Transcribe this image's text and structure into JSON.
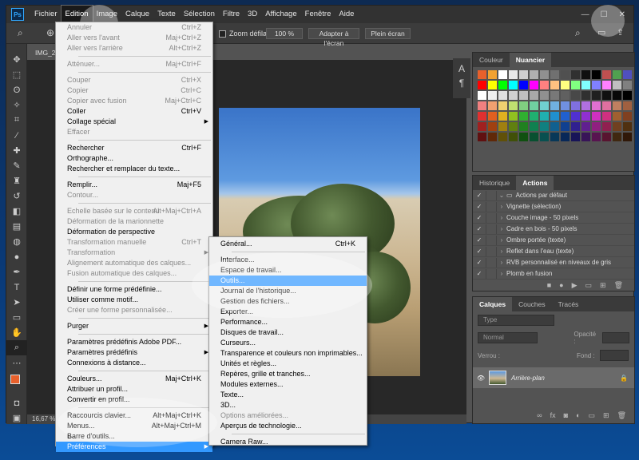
{
  "menubar": {
    "logo": "Ps",
    "items": [
      "Fichier",
      "Edition",
      "Image",
      "Calque",
      "Texte",
      "Sélection",
      "Filtre",
      "3D",
      "Affichage",
      "Fenêtre",
      "Aide"
    ],
    "active": "Edition",
    "window_controls": [
      "—",
      "☐",
      "✕"
    ]
  },
  "options": {
    "zoom_scroll_label": "Zoom défilant",
    "zoom_value": "100 %",
    "fit_screen": "Adapter à l'écran",
    "full_screen": "Plein écran"
  },
  "document": {
    "tab_label": "IMG_20",
    "status_zoom": "16,67 %"
  },
  "edit_menu": [
    {
      "label": "Annuler",
      "shortcut": "Ctrl+Z",
      "disabled": true
    },
    {
      "label": "Aller vers l'avant",
      "shortcut": "Maj+Ctrl+Z",
      "disabled": true
    },
    {
      "label": "Aller vers l'arrière",
      "shortcut": "Alt+Ctrl+Z",
      "disabled": true
    },
    {
      "sep": true
    },
    {
      "label": "Atténuer...",
      "shortcut": "Maj+Ctrl+F",
      "disabled": true
    },
    {
      "sep": true
    },
    {
      "label": "Couper",
      "shortcut": "Ctrl+X",
      "disabled": true
    },
    {
      "label": "Copier",
      "shortcut": "Ctrl+C",
      "disabled": true
    },
    {
      "label": "Copier avec fusion",
      "shortcut": "Maj+Ctrl+C",
      "disabled": true
    },
    {
      "label": "Coller",
      "shortcut": "Ctrl+V",
      "disabled": false
    },
    {
      "label": "Collage spécial",
      "shortcut": "",
      "disabled": false,
      "submenu": true
    },
    {
      "label": "Effacer",
      "shortcut": "",
      "disabled": true
    },
    {
      "sep": true
    },
    {
      "label": "Rechercher",
      "shortcut": "Ctrl+F",
      "disabled": false
    },
    {
      "label": "Orthographe...",
      "shortcut": "",
      "disabled": false
    },
    {
      "label": "Rechercher et remplacer du texte...",
      "shortcut": "",
      "disabled": false
    },
    {
      "sep": true
    },
    {
      "label": "Remplir...",
      "shortcut": "Maj+F5",
      "disabled": false
    },
    {
      "label": "Contour...",
      "shortcut": "",
      "disabled": true
    },
    {
      "sep": true
    },
    {
      "label": "Echelle basée sur le contenu",
      "shortcut": "Alt+Maj+Ctrl+A",
      "disabled": true
    },
    {
      "label": "Déformation de la marionnette",
      "shortcut": "",
      "disabled": true
    },
    {
      "label": "Déformation de perspective",
      "shortcut": "",
      "disabled": false
    },
    {
      "label": "Transformation manuelle",
      "shortcut": "Ctrl+T",
      "disabled": true
    },
    {
      "label": "Transformation",
      "shortcut": "",
      "disabled": true,
      "submenu": true
    },
    {
      "label": "Alignement automatique des calques...",
      "shortcut": "",
      "disabled": true
    },
    {
      "label": "Fusion automatique des calques...",
      "shortcut": "",
      "disabled": true
    },
    {
      "sep": true
    },
    {
      "label": "Définir une forme prédéfinie...",
      "shortcut": "",
      "disabled": false
    },
    {
      "label": "Utiliser comme motif...",
      "shortcut": "",
      "disabled": false
    },
    {
      "label": "Créer une forme personnalisée...",
      "shortcut": "",
      "disabled": true
    },
    {
      "sep": true
    },
    {
      "label": "Purger",
      "shortcut": "",
      "disabled": false,
      "submenu": true
    },
    {
      "sep": true
    },
    {
      "label": "Paramètres prédéfinis Adobe PDF...",
      "shortcut": "",
      "disabled": false
    },
    {
      "label": "Paramètres prédéfinis",
      "shortcut": "",
      "disabled": false,
      "submenu": true
    },
    {
      "label": "Connexions à distance...",
      "shortcut": "",
      "disabled": false
    },
    {
      "sep": true
    },
    {
      "label": "Couleurs...",
      "shortcut": "Maj+Ctrl+K",
      "disabled": false
    },
    {
      "label": "Attribuer un profil...",
      "shortcut": "",
      "disabled": false
    },
    {
      "label": "Convertir en profil...",
      "shortcut": "",
      "disabled": false
    },
    {
      "sep": true
    },
    {
      "label": "Raccourcis clavier...",
      "shortcut": "Alt+Maj+Ctrl+K",
      "disabled": false
    },
    {
      "label": "Menus...",
      "shortcut": "Alt+Maj+Ctrl+M",
      "disabled": false
    },
    {
      "label": "Barre d'outils...",
      "shortcut": "",
      "disabled": false
    },
    {
      "label": "Préférences",
      "shortcut": "",
      "disabled": false,
      "submenu": true,
      "highlighted": true
    }
  ],
  "prefs_menu": [
    {
      "label": "Général...",
      "shortcut": "Ctrl+K",
      "disabled": false
    },
    {
      "sep": true
    },
    {
      "label": "Interface...",
      "shortcut": "",
      "disabled": false
    },
    {
      "label": "Espace de travail...",
      "shortcut": "",
      "disabled": false
    },
    {
      "label": "Outils...",
      "shortcut": "",
      "disabled": false,
      "highlighted": true
    },
    {
      "label": "Journal de l'historique...",
      "shortcut": "",
      "disabled": false
    },
    {
      "label": "Gestion des fichiers...",
      "shortcut": "",
      "disabled": false
    },
    {
      "label": "Exporter...",
      "shortcut": "",
      "disabled": false
    },
    {
      "label": "Performance...",
      "shortcut": "",
      "disabled": false
    },
    {
      "label": "Disques de travail...",
      "shortcut": "",
      "disabled": false
    },
    {
      "label": "Curseurs...",
      "shortcut": "",
      "disabled": false
    },
    {
      "label": "Transparence et couleurs non imprimables...",
      "shortcut": "",
      "disabled": false
    },
    {
      "label": "Unités et règles...",
      "shortcut": "",
      "disabled": false
    },
    {
      "label": "Repères, grille et tranches...",
      "shortcut": "",
      "disabled": false
    },
    {
      "label": "Modules externes...",
      "shortcut": "",
      "disabled": false
    },
    {
      "label": "Texte...",
      "shortcut": "",
      "disabled": false
    },
    {
      "label": "3D...",
      "shortcut": "",
      "disabled": false
    },
    {
      "label": "Options améliorées...",
      "shortcut": "",
      "disabled": true
    },
    {
      "label": "Aperçus de technologie...",
      "shortcut": "",
      "disabled": false
    },
    {
      "sep": true
    },
    {
      "label": "Camera Raw...",
      "shortcut": "",
      "disabled": false
    }
  ],
  "swatches_panel": {
    "tabs": [
      "Couleur",
      "Nuancier"
    ],
    "active": "Nuancier",
    "colors": [
      "#e8602b",
      "#f1a132",
      "#ffffff",
      "#e8e8e8",
      "#d0d0d0",
      "#b0b0b0",
      "#909090",
      "#707070",
      "#505050",
      "#303030",
      "#101010",
      "#000000",
      "#c05050",
      "#50a050",
      "#5050c0",
      "#ff0000",
      "#ffff00",
      "#00ff00",
      "#00ffff",
      "#0000ff",
      "#ff00ff",
      "#ff8080",
      "#ffc080",
      "#ffff80",
      "#80ff80",
      "#80ffff",
      "#8080ff",
      "#ff80ff",
      "#c0c0c0",
      "#808080",
      "#ffffff",
      "#f0f0f0",
      "#e0e0e0",
      "#d0d0d0",
      "#c0c0c0",
      "#a8a8a8",
      "#909090",
      "#787878",
      "#606060",
      "#484848",
      "#303030",
      "#202020",
      "#101010",
      "#080808",
      "#000000",
      "#f08080",
      "#f0a070",
      "#f0d070",
      "#c0e070",
      "#80d080",
      "#70d0a0",
      "#70d0d0",
      "#70b0e0",
      "#7090e0",
      "#8070e0",
      "#b070e0",
      "#e070d0",
      "#e070a0",
      "#c08060",
      "#a06040",
      "#e03030",
      "#e06020",
      "#e0b020",
      "#90c020",
      "#30b030",
      "#20b070",
      "#20b0b0",
      "#2090d0",
      "#2060d0",
      "#5030d0",
      "#9030d0",
      "#d030c0",
      "#d03080",
      "#a06030",
      "#804020",
      "#a02020",
      "#a04010",
      "#a08010",
      "#608010",
      "#208020",
      "#108050",
      "#108080",
      "#106090",
      "#104090",
      "#302090",
      "#602090",
      "#902080",
      "#902050",
      "#704020",
      "#503010",
      "#601010",
      "#602808",
      "#605008",
      "#405008",
      "#105010",
      "#085030",
      "#085050",
      "#083858",
      "#082858",
      "#181458",
      "#381458",
      "#581450",
      "#581430",
      "#402810",
      "#301808"
    ]
  },
  "actions_panel": {
    "tabs": [
      "Historique",
      "Actions"
    ],
    "active": "Actions",
    "items": [
      {
        "label": "Actions par défaut",
        "checked": true,
        "folder": true
      },
      {
        "label": "Vignette (sélection)",
        "checked": true
      },
      {
        "label": "Couche image - 50 pixels",
        "checked": true
      },
      {
        "label": "Cadre en bois - 50 pixels",
        "checked": true
      },
      {
        "label": "Ombre portée (texte)",
        "checked": true
      },
      {
        "label": "Reflet dans l'eau (texte)",
        "checked": true
      },
      {
        "label": "RVB personnalisé en niveaux de gris",
        "checked": true
      },
      {
        "label": "Plomb en fusion",
        "checked": true
      }
    ]
  },
  "layers_panel": {
    "tabs": [
      "Calques",
      "Couches",
      "Tracés"
    ],
    "active": "Calques",
    "filter_label": "Type",
    "blend_mode": "Normal",
    "opacity_label": "Opacité :",
    "lock_label": "Verrou :",
    "fill_label": "Fond :",
    "layer_name": "Arrière-plan"
  }
}
